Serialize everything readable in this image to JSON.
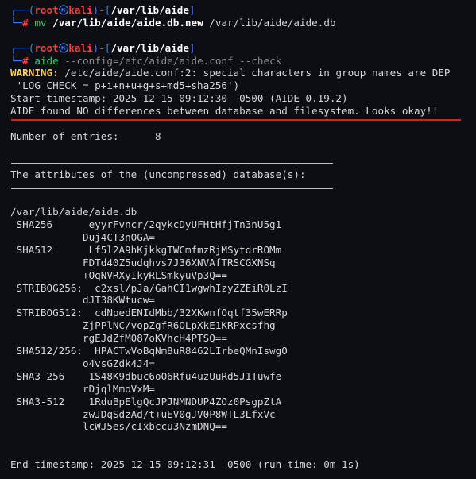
{
  "prompt1": {
    "corner_top": "┌──(",
    "user": "root",
    "at": "㉿",
    "host": "kali",
    "mid": ")-[",
    "path": "/var/lib/aide",
    "end": "]",
    "corner_bottom": "└─",
    "hash": "# ",
    "cmd": "mv",
    "arg1": "/var/lib/aide/aide.db.new",
    "arg2": "/var/lib/aide/aide.db"
  },
  "prompt2": {
    "corner_top": "┌──(",
    "user": "root",
    "at": "㉿",
    "host": "kali",
    "mid": ")-[",
    "path": "/var/lib/aide",
    "end": "]",
    "corner_bottom": "└─",
    "hash": "# ",
    "cmd": "aide",
    "args": "--config=/etc/aide/aide.conf --check"
  },
  "output": {
    "warning_label": "WARNING:",
    "warning_text": " /etc/aide/aide.conf:2: special characters in group names are DEP",
    "warning_cont": " 'LOG_CHECK = p+i+n+u+g+s+md5+sha256')",
    "start": "Start timestamp: 2025-12-15 09:12:30 -0500 (AIDE 0.19.2)",
    "result": "AIDE found NO differences between database and filesystem. Looks okay!!",
    "entries_label": "Number of entries:",
    "entries_value": "8",
    "attributes_title": "The attributes of the (uncompressed) database(s):",
    "db_path": "/var/lib/aide/aide.db",
    "hashes": [
      {
        "name": "SHA256",
        "lines": [
          "eyyrFvncr/2qykcDyUFHtHfjTn3nU5g1",
          "Duj4CT3nOGA="
        ]
      },
      {
        "name": "SHA512",
        "lines": [
          "Lf5l2A9hKjkkgTWCmfmzRjMSytdrROMm",
          "FDTd40Z5udqhvs7J36XNVAfTRSCGXNSq",
          "+OqNVRXyIkyRLSmkyuVp3Q=="
        ]
      },
      {
        "name": "STRIBOG256:",
        "lines": [
          "c2xsl/pJa/GahCI1wgwhIzyZZEiR0LzI",
          "dJT38KWtucw="
        ]
      },
      {
        "name": "STRIBOG512:",
        "lines": [
          "cdNpedENIdMbb/32XKwnfOqtf35wERRp",
          "ZjPPlNC/vopZgfR6OLpXkE1KRPxcsfhg",
          "rgEJdZfM087oKVhcH4PTSQ=="
        ]
      },
      {
        "name": "SHA512/256:",
        "lines": [
          "HPACTwVoBqNm8uR8462LIrbeQMnIswgO",
          "o4vsGZdk4J4="
        ]
      },
      {
        "name": "SHA3-256",
        "lines": [
          "1S48K9dbuc6oO6Rfu4uzUuRd5J1Tuwfe",
          "rDjqlMmoVxM="
        ]
      },
      {
        "name": "SHA3-512",
        "lines": [
          "1RduBpElgQcJPJNMNDUP4ZOz0PsgpZtA",
          "zwJDqSdzAd/t+uEV0gJV0P8WTL3LfxVc",
          "lcWJ5es/cIxbccu3NzmDNQ=="
        ]
      }
    ],
    "end": "End timestamp: 2025-12-15 09:12:31 -0500 (run time: 0m 1s)"
  }
}
